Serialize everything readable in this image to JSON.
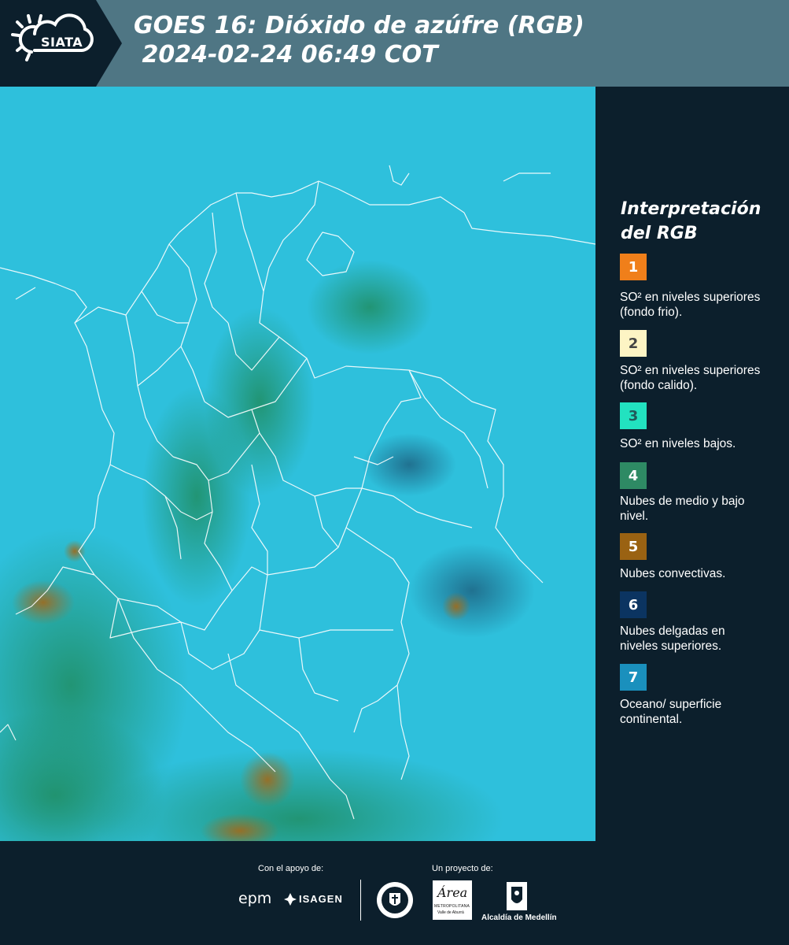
{
  "header": {
    "logo_text": "SIATA",
    "title": "GOES 16: Dióxido de azúfre (RGB)\n 2024-02-24 06:49 COT"
  },
  "legend": {
    "title": "Interpretación del RGB",
    "items": [
      {
        "number": "1",
        "color": "#f07f1a",
        "text_color": "#ffffff",
        "label": "SO² en niveles superiores (fondo frio)."
      },
      {
        "number": "2",
        "color": "#fdf4c4",
        "text_color": "#444444",
        "label": "SO² en niveles superiores (fondo calido)."
      },
      {
        "number": "3",
        "color": "#22e2c0",
        "text_color": "#215a5a",
        "label": "SO² en niveles bajos."
      },
      {
        "number": "4",
        "color": "#2e8a64",
        "text_color": "#ffffff",
        "label": "Nubes de medio y bajo nivel."
      },
      {
        "number": "5",
        "color": "#9a6212",
        "text_color": "#ffffff",
        "label": "Nubes convectivas."
      },
      {
        "number": "6",
        "color": "#0b3461",
        "text_color": "#ffffff",
        "label": "Nubes delgadas en niveles superiores."
      },
      {
        "number": "7",
        "color": "#1a90bd",
        "text_color": "#ffffff",
        "label": "Oceano/ superficie continental."
      }
    ]
  },
  "footer": {
    "support_label": "Con el apoyo de:",
    "project_label": "Un proyecto de:",
    "epm": "epm",
    "isagen": "ISAGEN",
    "area_text": "Área",
    "metropolitana_text": "METROPOLITANA",
    "valle_text": "Valle de Aburrá",
    "medellin_text": "Alcaldía de Medellín"
  },
  "colors": {
    "background": "#0c1f2c",
    "header": "#4f7684",
    "map_base": "#2ec0dc",
    "border": "#ffffff"
  }
}
